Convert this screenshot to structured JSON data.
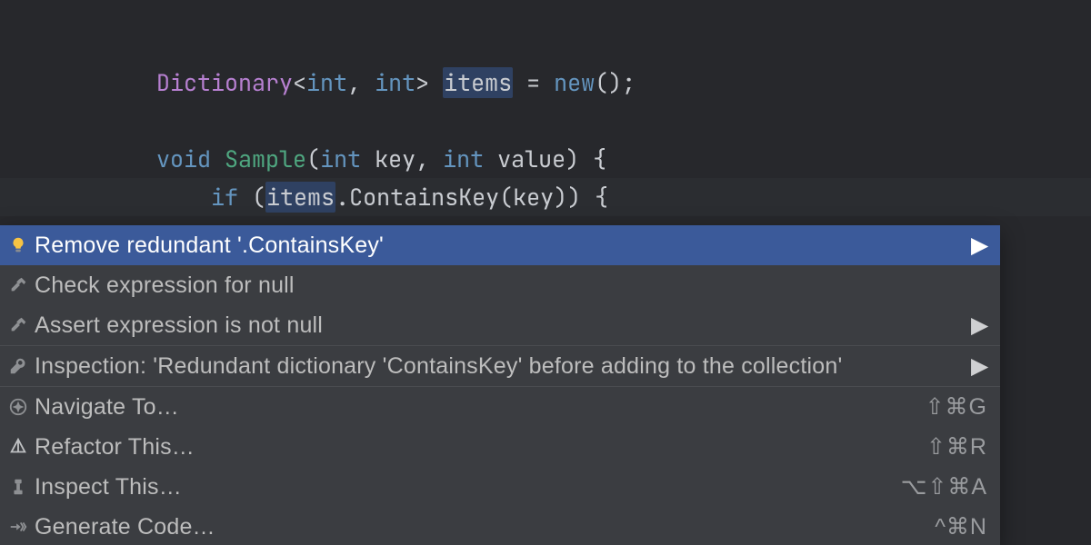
{
  "code": {
    "line1": {
      "type": "Dictionary",
      "lt": "<",
      "t1": "int",
      "comma": ", ",
      "t2": "int",
      "gt": "> ",
      "var": "items",
      "eq": " = ",
      "newkw": "new",
      "tail": "();"
    },
    "line2": {
      "kw": "void",
      "sp1": " ",
      "name": "Sample",
      "open": "(",
      "p1t": "int",
      "p1s": " ",
      "p1n": "key",
      "comma": ", ",
      "p2t": "int",
      "p2s": " ",
      "p2n": "value",
      "close": ") {"
    },
    "line3": {
      "indent": "    ",
      "kw": "if",
      "sp": " (",
      "obj": "items",
      "dot": ".",
      "method": "ContainsKey",
      "argopen": "(",
      "arg": "key",
      "argclose": "))",
      "tail": " {"
    }
  },
  "menu": {
    "groups": [
      {
        "items": [
          {
            "icon": "lightbulb",
            "label": "Remove redundant '.ContainsKey'",
            "submenu": true,
            "selected": true
          },
          {
            "icon": "hammer",
            "label": "Check expression for null"
          },
          {
            "icon": "hammer",
            "label": "Assert expression is not null",
            "submenu": true
          }
        ]
      },
      {
        "items": [
          {
            "icon": "wrench",
            "label": "Inspection: 'Redundant dictionary 'ContainsKey' before adding to the collection'",
            "submenu": true
          }
        ]
      },
      {
        "items": [
          {
            "icon": "compass",
            "label": "Navigate To…",
            "shortcut": "⇧⌘G"
          },
          {
            "icon": "prism",
            "label": "Refactor This…",
            "shortcut": "⇧⌘R"
          },
          {
            "icon": "inspect",
            "label": "Inspect This…",
            "shortcut": "⌥⇧⌘A"
          },
          {
            "icon": "generate",
            "label": "Generate Code…",
            "shortcut": "^⌘N"
          }
        ]
      }
    ]
  },
  "colors": {
    "bulb_fill": "#f6c344",
    "bulb_base": "#5a5b5e"
  }
}
